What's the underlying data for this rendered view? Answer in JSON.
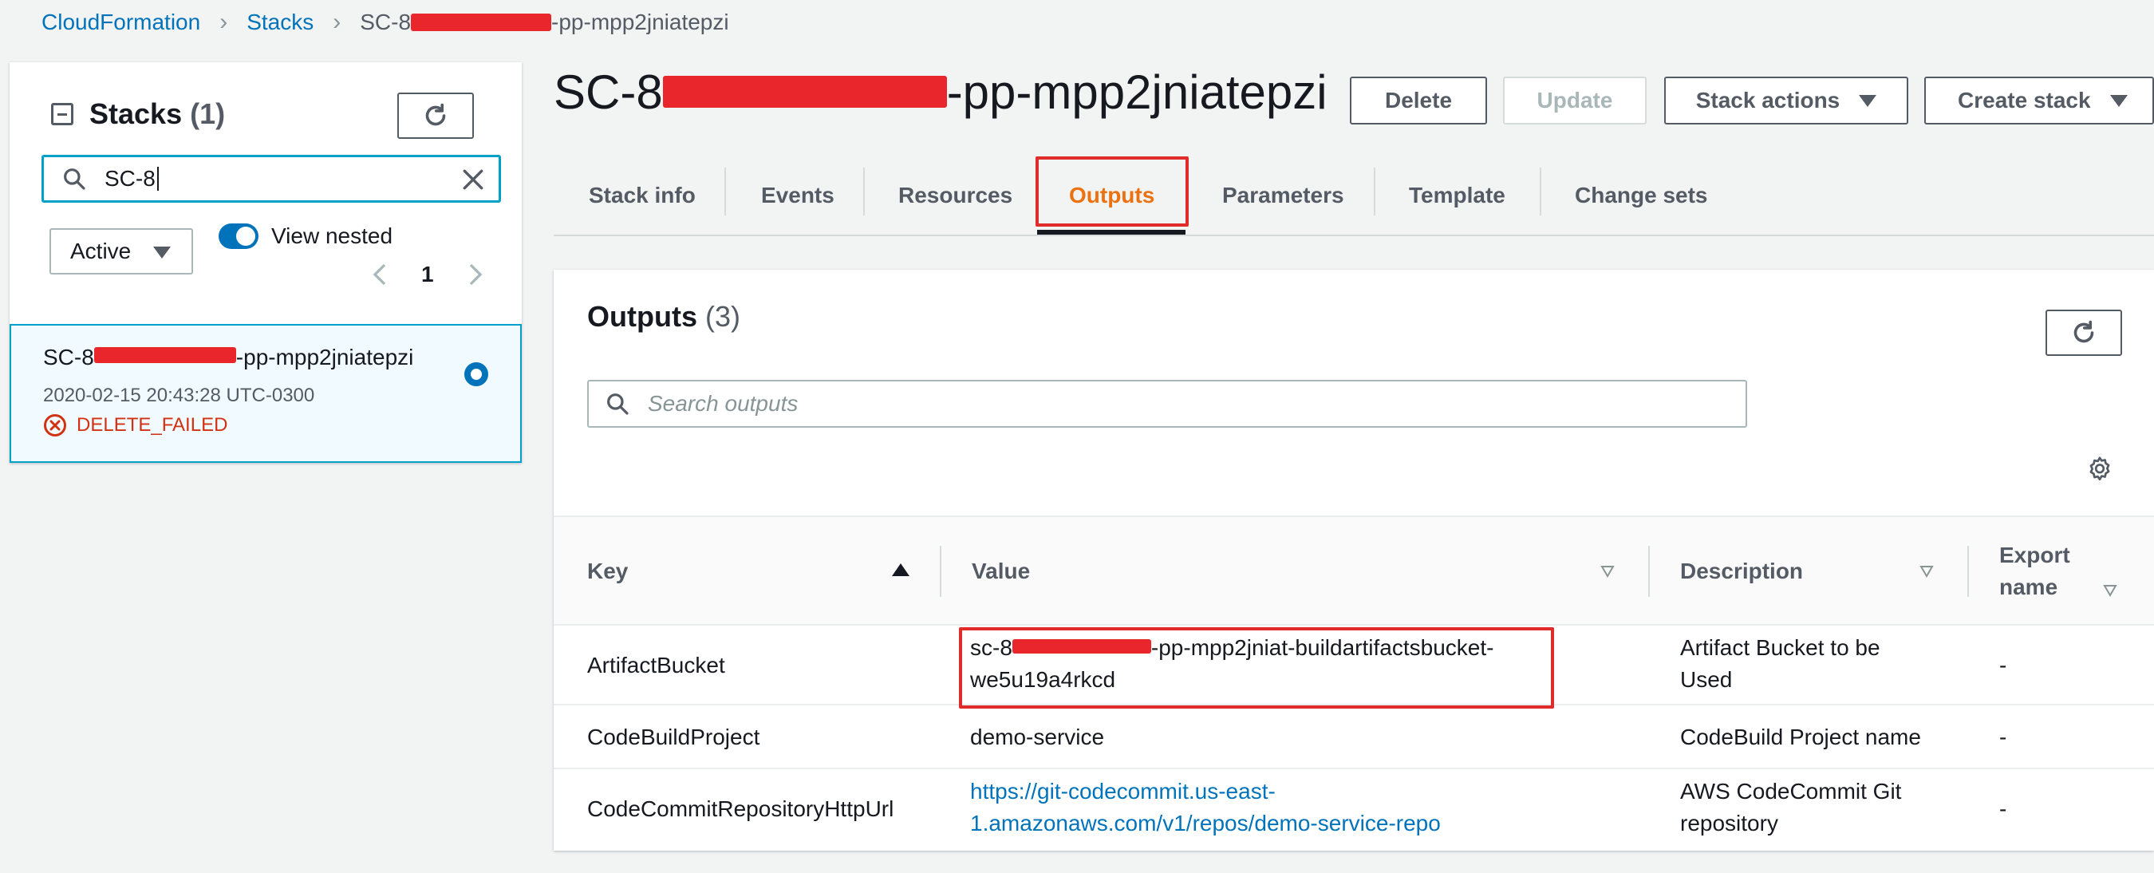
{
  "breadcrumb": {
    "items": [
      "CloudFormation",
      "Stacks"
    ],
    "current_prefix": "SC-8",
    "current_suffix": "-pp-mpp2jniatepzi"
  },
  "stacks_panel": {
    "title": "Stacks",
    "count": "(1)",
    "search_value": "SC-8",
    "filter_value": "Active",
    "view_nested_label": "View nested",
    "view_nested_on": true,
    "page": "1",
    "stacks": [
      {
        "name_prefix": "SC-8",
        "name_suffix": "-pp-mpp2jniatepzi",
        "date": "2020-02-15 20:43:28 UTC-0300",
        "status": "DELETE_FAILED",
        "selected": true
      }
    ]
  },
  "header": {
    "title_prefix": "SC-8",
    "title_suffix": "-pp-mpp2jniatepzi",
    "buttons": {
      "delete": "Delete",
      "update": "Update",
      "stack_actions": "Stack actions",
      "create_stack": "Create stack"
    }
  },
  "tabs": [
    {
      "label": "Stack info"
    },
    {
      "label": "Events"
    },
    {
      "label": "Resources"
    },
    {
      "label": "Outputs",
      "active": true
    },
    {
      "label": "Parameters"
    },
    {
      "label": "Template"
    },
    {
      "label": "Change sets"
    }
  ],
  "outputs": {
    "title": "Outputs",
    "count": "(3)",
    "search_placeholder": "Search outputs",
    "columns": [
      "Key",
      "Value",
      "Description",
      "Export name"
    ],
    "rows": [
      {
        "key": "ArtifactBucket",
        "value_line1_prefix": "sc-8",
        "value_line1_suffix": "-pp-mpp2jniat-buildartifactsbucket-",
        "value_line2": "we5u19a4rkcd",
        "description_line1": "Artifact Bucket to be",
        "description_line2": "Used",
        "export": "-"
      },
      {
        "key": "CodeBuildProject",
        "value": "demo-service",
        "description": "CodeBuild Project name",
        "export": "-"
      },
      {
        "key": "CodeCommitRepositoryHttpUrl",
        "value_line1": "https://git-codecommit.us-east-",
        "value_line2": "1.amazonaws.com/v1/repos/demo-service-repo",
        "description_line1": "AWS CodeCommit Git",
        "description_line2": "repository",
        "export": "-"
      }
    ]
  },
  "colors": {
    "link": "#0073bb",
    "active_tab": "#ec7211",
    "error": "#d13212",
    "highlight": "#e02b2b",
    "redaction": "#e8262b"
  }
}
